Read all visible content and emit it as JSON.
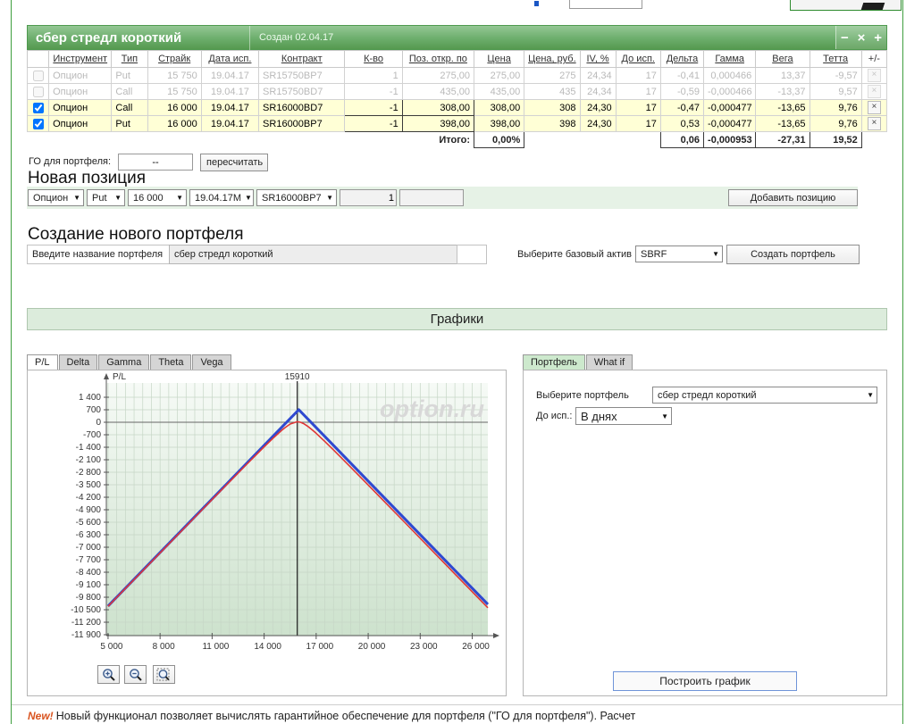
{
  "portfolio_header": {
    "title": "сбер стредл короткий",
    "created": "Создан 02.04.17",
    "collapse": "−",
    "close": "×",
    "add": "+"
  },
  "table": {
    "columns": [
      "Инструмент",
      "Тип",
      "Страйк",
      "Дата исп.",
      "Контракт",
      "К-во",
      "Поз. откр. по",
      "Цена",
      "Цена, руб.",
      "IV, %",
      "До исп.",
      "Дельта",
      "Гамма",
      "Вега",
      "Тетта",
      "+/-"
    ],
    "rows": [
      {
        "checked": false,
        "enabled": false,
        "instrument": "Опцион",
        "type": "Put",
        "strike": "15 750",
        "date": "19.04.17",
        "contract": "SR15750BP7",
        "qty": "1",
        "pos": "275,00",
        "price": "275,00",
        "price_rub": "275",
        "iv": "24,34",
        "days": "17",
        "delta": "-0,41",
        "gamma": "0,000466",
        "vega": "13,37",
        "theta": "-9,57",
        "delete": "×"
      },
      {
        "checked": false,
        "enabled": false,
        "instrument": "Опцион",
        "type": "Call",
        "strike": "15 750",
        "date": "19.04.17",
        "contract": "SR15750BD7",
        "qty": "-1",
        "pos": "435,00",
        "price": "435,00",
        "price_rub": "435",
        "iv": "24,34",
        "days": "17",
        "delta": "-0,59",
        "gamma": "-0,000466",
        "vega": "-13,37",
        "theta": "9,57",
        "delete": "×"
      },
      {
        "checked": true,
        "enabled": true,
        "instrument": "Опцион",
        "type": "Call",
        "strike": "16 000",
        "date": "19.04.17",
        "contract": "SR16000BD7",
        "qty": "-1",
        "pos": "308,00",
        "price": "308,00",
        "price_rub": "308",
        "iv": "24,30",
        "days": "17",
        "delta": "-0,47",
        "gamma": "-0,000477",
        "vega": "-13,65",
        "theta": "9,76",
        "delete": "×"
      },
      {
        "checked": true,
        "enabled": true,
        "instrument": "Опцион",
        "type": "Put",
        "strike": "16 000",
        "date": "19.04.17",
        "contract": "SR16000BP7",
        "qty": "-1",
        "pos": "398,00",
        "price": "398,00",
        "price_rub": "398",
        "iv": "24,30",
        "days": "17",
        "delta": "0,53",
        "gamma": "-0,000477",
        "vega": "-13,65",
        "theta": "9,76",
        "delete": "×"
      }
    ],
    "totals": {
      "label": "Итого:",
      "pct": "0,00%",
      "delta": "0,06",
      "gamma": "-0,000953",
      "vega": "-27,31",
      "theta": "19,52"
    }
  },
  "go": {
    "label": "ГО для портфеля:",
    "value": "--",
    "recalc_button": "пересчитать"
  },
  "new_position": {
    "heading": "Новая позиция",
    "instrument": "Опцион",
    "type": "Put",
    "strike": "16 000",
    "expiry": "19.04.17M",
    "contract": "SR16000BP7",
    "qty": "1",
    "add_button": "Добавить позицию"
  },
  "create_portfolio": {
    "heading": "Создание нового портфеля",
    "name_label": "Введите название портфеля",
    "name_value": "сбер стредл короткий",
    "asset_label": "Выберите базовый актив",
    "asset_value": "SBRF",
    "create_button": "Создать портфель"
  },
  "charts": {
    "section_title": "Графики",
    "left_tabs": [
      {
        "label": "P/L",
        "active": true
      },
      {
        "label": "Delta",
        "active": false
      },
      {
        "label": "Gamma",
        "active": false
      },
      {
        "label": "Theta",
        "active": false
      },
      {
        "label": "Vega",
        "active": false
      }
    ],
    "right_tabs": [
      {
        "label": "Портфель",
        "active": true
      },
      {
        "label": "What if",
        "active": false
      }
    ],
    "portfolio_label": "Выберите портфель",
    "portfolio_value": "сбер стредл короткий",
    "days_label": "До исп.:",
    "days_value": "В днях",
    "build_button": "Построить график"
  },
  "footer": {
    "badge": "New!",
    "text": "Новый функционал позволяет вычислять гарантийное обеспечение для портфеля (\"ГО для портфеля\"). Расчет"
  },
  "chart_data": {
    "type": "line",
    "title": "P/L",
    "watermark": "option.ru",
    "xlim": [
      4900,
      26900
    ],
    "ylim": [
      -11950,
      2200
    ],
    "x_ticks": [
      5000,
      8000,
      11000,
      14000,
      17000,
      20000,
      23000,
      26000
    ],
    "y_ticks": [
      1400,
      700,
      0,
      -700,
      -1400,
      -2100,
      -2800,
      -3500,
      -4200,
      -4900,
      -5600,
      -6300,
      -7000,
      -7700,
      -8400,
      -9100,
      -9800,
      -10500,
      -11200,
      -11900
    ],
    "grid_x_step": 500,
    "marker": {
      "x": 15910,
      "label": "15910"
    },
    "series": [
      {
        "name": "expiration-pl",
        "color": "#2f49d0",
        "width": 3,
        "points": [
          [
            5000,
            -10294
          ],
          [
            16000,
            706
          ],
          [
            26900,
            -10194
          ]
        ]
      },
      {
        "name": "current-pl",
        "color": "#e03636",
        "width": 1.6,
        "points": [
          [
            5000,
            -10310
          ],
          [
            6000,
            -9311
          ],
          [
            7000,
            -8313
          ],
          [
            8000,
            -7316
          ],
          [
            9000,
            -6319
          ],
          [
            10000,
            -5323
          ],
          [
            11000,
            -4329
          ],
          [
            12000,
            -3338
          ],
          [
            13000,
            -2352
          ],
          [
            14000,
            -1382
          ],
          [
            14500,
            -911
          ],
          [
            15000,
            -466
          ],
          [
            15200,
            -305
          ],
          [
            15500,
            -99
          ],
          [
            15910,
            30
          ],
          [
            16100,
            0
          ],
          [
            16300,
            -88
          ],
          [
            16500,
            -216
          ],
          [
            16800,
            -450
          ],
          [
            17000,
            -622
          ],
          [
            17500,
            -1078
          ],
          [
            18000,
            -1555
          ],
          [
            18500,
            -2040
          ],
          [
            19000,
            -2529
          ],
          [
            20000,
            -3516
          ],
          [
            21000,
            -4508
          ],
          [
            22000,
            -5502
          ],
          [
            23000,
            -6498
          ],
          [
            24000,
            -7495
          ],
          [
            25000,
            -8493
          ],
          [
            26000,
            -9491
          ],
          [
            26900,
            -10390
          ]
        ]
      }
    ]
  }
}
